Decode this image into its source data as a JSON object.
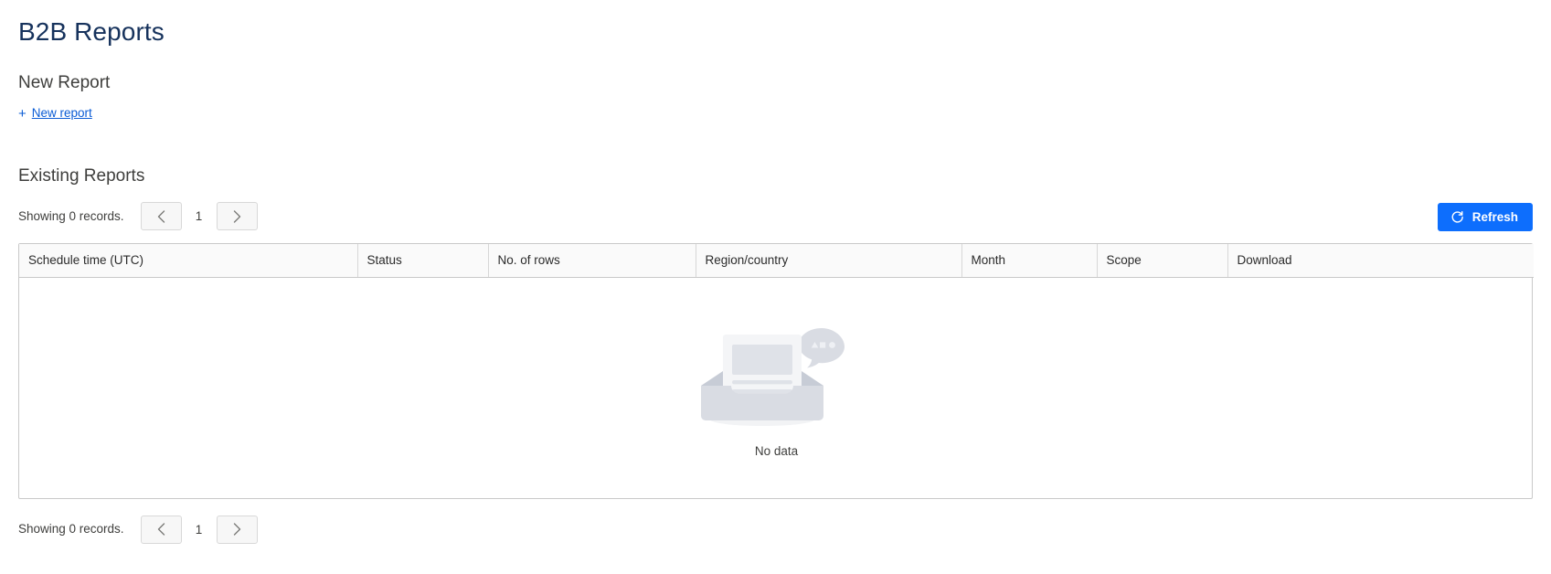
{
  "page": {
    "title": "B2B Reports"
  },
  "new_report": {
    "heading": "New Report",
    "link_plus": "+",
    "link_label": "New report",
    "link_icon": "plus-icon"
  },
  "existing_reports": {
    "heading": "Existing Reports",
    "top_pager": {
      "records_label": "Showing 0 records.",
      "prev_icon": "chevron-left-icon",
      "page_number": "1",
      "next_icon": "chevron-right-icon"
    },
    "bottom_pager": {
      "records_label": "Showing 0 records.",
      "prev_icon": "chevron-left-icon",
      "page_number": "1",
      "next_icon": "chevron-right-icon"
    },
    "refresh_button": {
      "label": "Refresh",
      "icon": "refresh-icon",
      "color": "#0d6efd"
    },
    "table": {
      "columns": [
        "Schedule time (UTC)",
        "Status",
        "No. of rows",
        "Region/country",
        "Month",
        "Scope",
        "Download"
      ],
      "rows": [],
      "empty_state": {
        "illustration": "empty-inbox-illustration",
        "text": "No data"
      }
    }
  },
  "colors": {
    "title": "#16325c",
    "heading": "#3e3e3c",
    "link": "#0b5cd5",
    "accent": "#0d6efd",
    "table_border": "#c9c9c9",
    "table_header_bg": "#fafafa",
    "empty_illustration": "#d9dce3"
  }
}
